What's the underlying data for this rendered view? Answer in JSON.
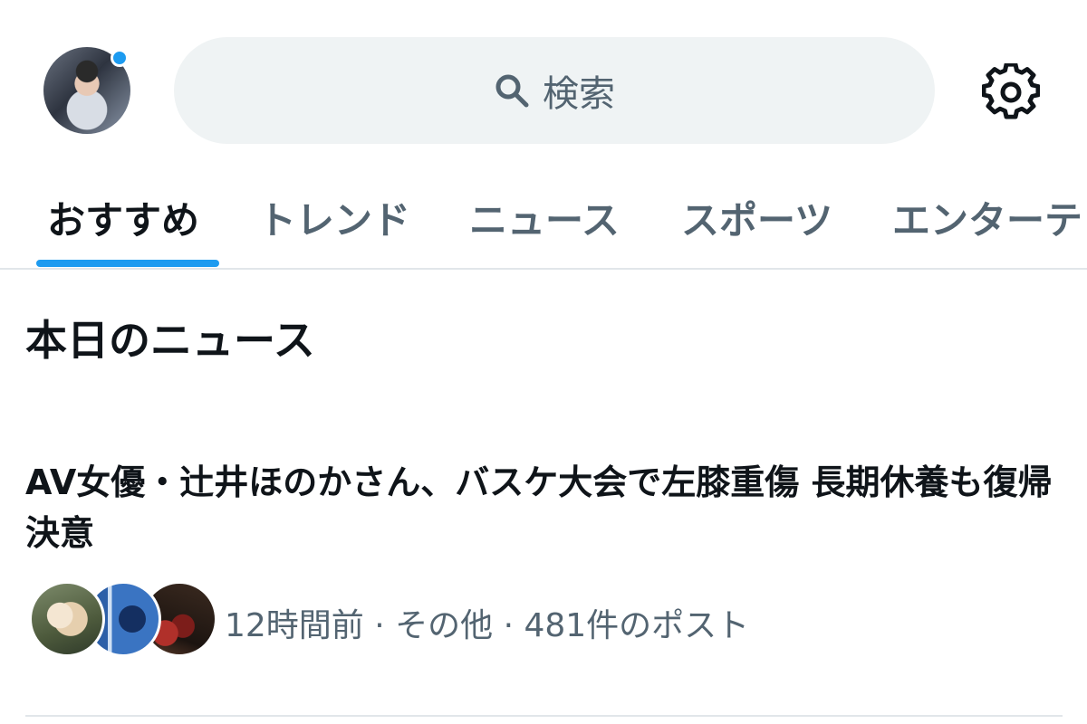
{
  "header": {
    "search_placeholder": "検索"
  },
  "tabs": [
    {
      "label": "おすすめ",
      "active": true
    },
    {
      "label": "トレンド",
      "active": false
    },
    {
      "label": "ニュース",
      "active": false
    },
    {
      "label": "スポーツ",
      "active": false
    },
    {
      "label": "エンターテ",
      "active": false
    }
  ],
  "section": {
    "title": "本日のニュース"
  },
  "news_item": {
    "headline": "AV女優・辻井ほのかさん、バスケ大会で左膝重傷 長期休養も復帰決意",
    "meta": "12時間前 · その他 · 481件のポスト"
  },
  "colors": {
    "accent": "#1d9bf0",
    "search_bg": "#eff3f4",
    "muted_text": "#536471",
    "primary_text": "#0f1419"
  }
}
